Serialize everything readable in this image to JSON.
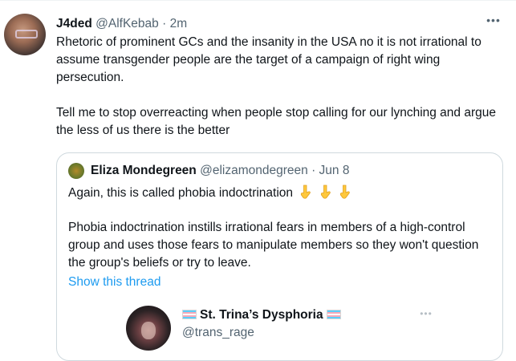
{
  "tweet": {
    "author_name": "J4ded",
    "author_handle": "@AlfKebab",
    "separator": "·",
    "time": "2m",
    "more_label": "•••",
    "text": "Rhetoric of prominent GCs and the insanity in the USA no it is not irrational to assume transgender people are the target of a campaign of right wing persecution.\n\nTell me to stop overreacting when people stop calling for our lynching and argue the less of us there is the better"
  },
  "quote": {
    "author_name": "Eliza Mondegreen",
    "author_handle": "@elizamondegreen",
    "separator": "·",
    "time": "Jun 8",
    "line1": "Again, this is called phobia indoctrination",
    "emoji": [
      "pointing-down-hand-icon",
      "pointing-down-hand-icon",
      "pointing-down-hand-icon"
    ],
    "paragraph": "Phobia indoctrination instills irrational fears in members of a high-control group and uses those fears to manipulate members so they won't question the group's beliefs or try to leave.",
    "show_thread": "Show this thread",
    "embedded": {
      "display_name": "St. Trina’s Dysphoria",
      "handle": "@trans_rage",
      "more_label": "•••",
      "flag_icon": "transgender-flag-icon"
    }
  },
  "colors": {
    "text": "#0f1419",
    "secondary": "#536471",
    "link": "#1d9bf0",
    "border": "#cfd9de"
  }
}
